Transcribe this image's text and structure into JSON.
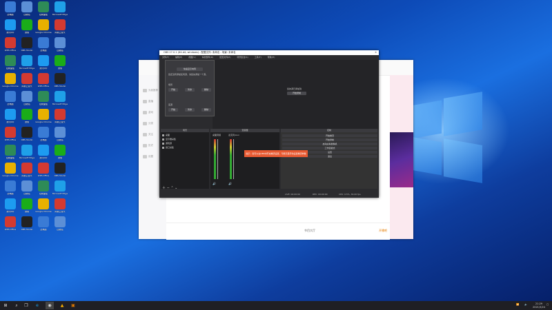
{
  "desktop": {
    "icons": [
      {
        "label": "此电脑",
        "icon": "computer-icon",
        "color": "#3a7bd5"
      },
      {
        "label": "回收站",
        "icon": "recycle-bin-icon",
        "color": "#5c8fd6"
      },
      {
        "label": "控制面板",
        "icon": "control-panel-icon",
        "color": "#2e8b57"
      },
      {
        "label": "Microsoft Edge",
        "icon": "edge-icon",
        "color": "#1fa0e8"
      },
      {
        "label": "腾讯QQ",
        "icon": "qq-icon",
        "color": "#1d9bf0"
      },
      {
        "label": "微信",
        "icon": "wechat-icon",
        "color": "#1aad19"
      },
      {
        "label": "Google Chrome",
        "icon": "chrome-icon",
        "color": "#e8b100"
      },
      {
        "label": "网易云音乐",
        "icon": "music-icon",
        "color": "#d33a31"
      },
      {
        "label": "WPS Office",
        "icon": "wps-icon",
        "color": "#d33a31"
      },
      {
        "label": "OBS Studio",
        "icon": "obs-icon",
        "color": "#222222"
      }
    ]
  },
  "taskbar": {
    "start_icon": "windows-logo-icon",
    "tray_time": "21:29",
    "tray_date": "2021/3/24"
  },
  "app": {
    "sidebar_items": [
      "为我推荐",
      "直播",
      "游戏",
      "分类",
      "关注",
      "历史",
      "设置"
    ],
    "bottom_text": "开播吧",
    "bottom_center": "节目大厅"
  },
  "obs": {
    "title": "OBS 27.0.1 (64-bit, windows) - 配置文件: 未命名 - 场景: 未命名",
    "menu": [
      "文件(F)",
      "编辑(E)",
      "视图(V)",
      "停靠部件(D)",
      "配置文件(P)",
      "场景集合(S)",
      "工具(T)",
      "帮助(H)"
    ],
    "popup": {
      "button_top": "快速显示向导",
      "text": "您还没有添加任何源，请您先添加一个源。",
      "section1": "场景",
      "section2": "来源",
      "btns": [
        "开始",
        "暂停",
        "删除"
      ]
    },
    "preview": {
      "line1": "您的源已添加到",
      "line2": "开始录制"
    },
    "tabs": {
      "scenes": "场景",
      "sources": "来源",
      "mixer": "混音器",
      "controls": "控制"
    },
    "sources": [
      "桌面",
      "显示器采集",
      "游戏源",
      "窗口采集"
    ],
    "mixer": {
      "ch1": "桌面音频",
      "ch2": "麦克风/Aux",
      "db1": "0.0 dB",
      "db2": "0.0 dB"
    },
    "controls": [
      "开始推流",
      "开始录制",
      "启动虚拟摄像机",
      "工作室模式",
      "设置",
      "退出"
    ],
    "tooltip": "提示：您可以在OBS中开启推流设置，可能无需手动设置推流参数",
    "status": {
      "live": "LIVE: 00:00:00",
      "rec": "REC: 00:00:00",
      "cpu": "CPU: 0.5%, 30.00 fps"
    }
  }
}
